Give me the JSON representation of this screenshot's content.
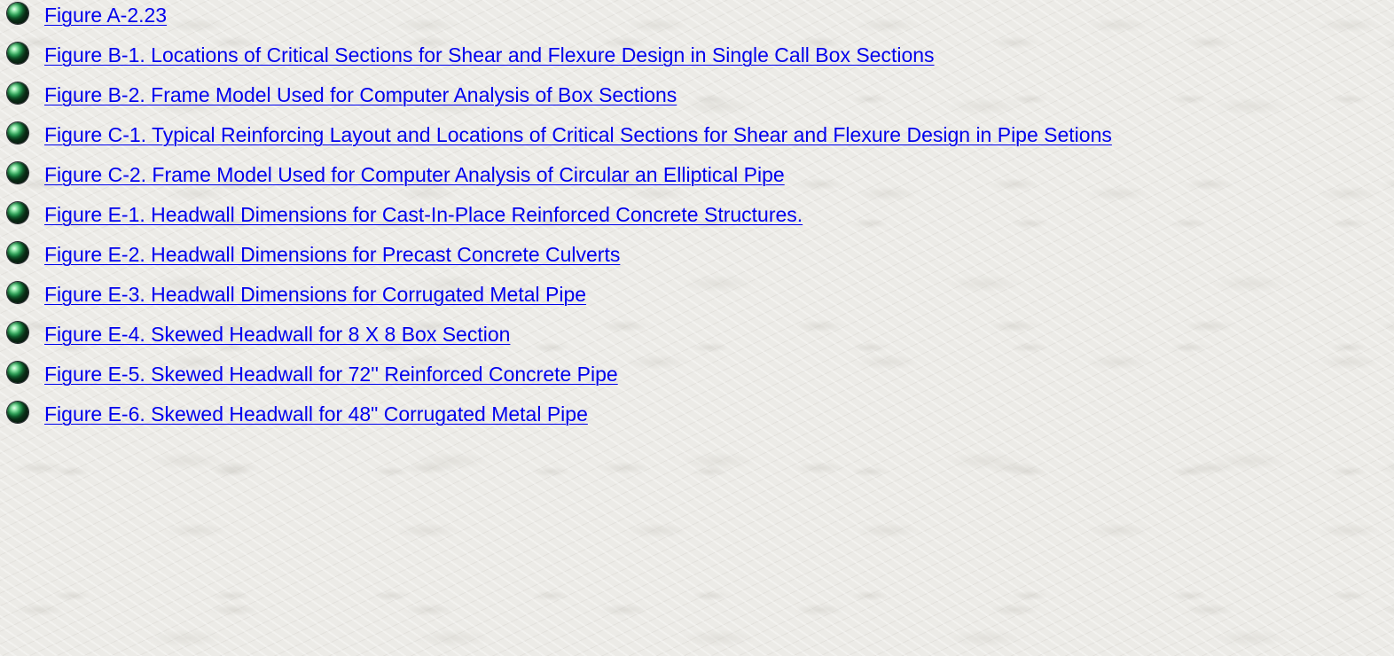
{
  "links": [
    {
      "label": "Figure A-2.23"
    },
    {
      "label": "Figure B-1. Locations of Critical Sections for Shear and Flexure Design in Single Call Box Sections"
    },
    {
      "label": "Figure B-2. Frame Model Used for Computer Analysis of Box Sections"
    },
    {
      "label": "Figure C-1. Typical Reinforcing Layout and Locations of Critical Sections for Shear and Flexure Design in Pipe Setions"
    },
    {
      "label": "Figure C-2. Frame Model Used for Computer Analysis of Circular an Elliptical Pipe"
    },
    {
      "label": "Figure E-1. Headwall Dimensions for Cast-In-Place Reinforced Concrete Structures."
    },
    {
      "label": "Figure E-2. Headwall Dimensions for Precast Concrete Culverts"
    },
    {
      "label": "Figure E-3. Headwall Dimensions for Corrugated Metal Pipe"
    },
    {
      "label": "Figure E-4. Skewed Headwall for 8 X 8 Box Section"
    },
    {
      "label": "Figure E-5. Skewed Headwall for 72'' Reinforced Concrete Pipe"
    },
    {
      "label": "Figure E-6. Skewed Headwall for 48\" Corrugated Metal Pipe"
    }
  ],
  "icons": {
    "bullet": "green-sphere-bullet-icon"
  },
  "colors": {
    "link": "#0000ee",
    "background": "#ecebe7"
  }
}
